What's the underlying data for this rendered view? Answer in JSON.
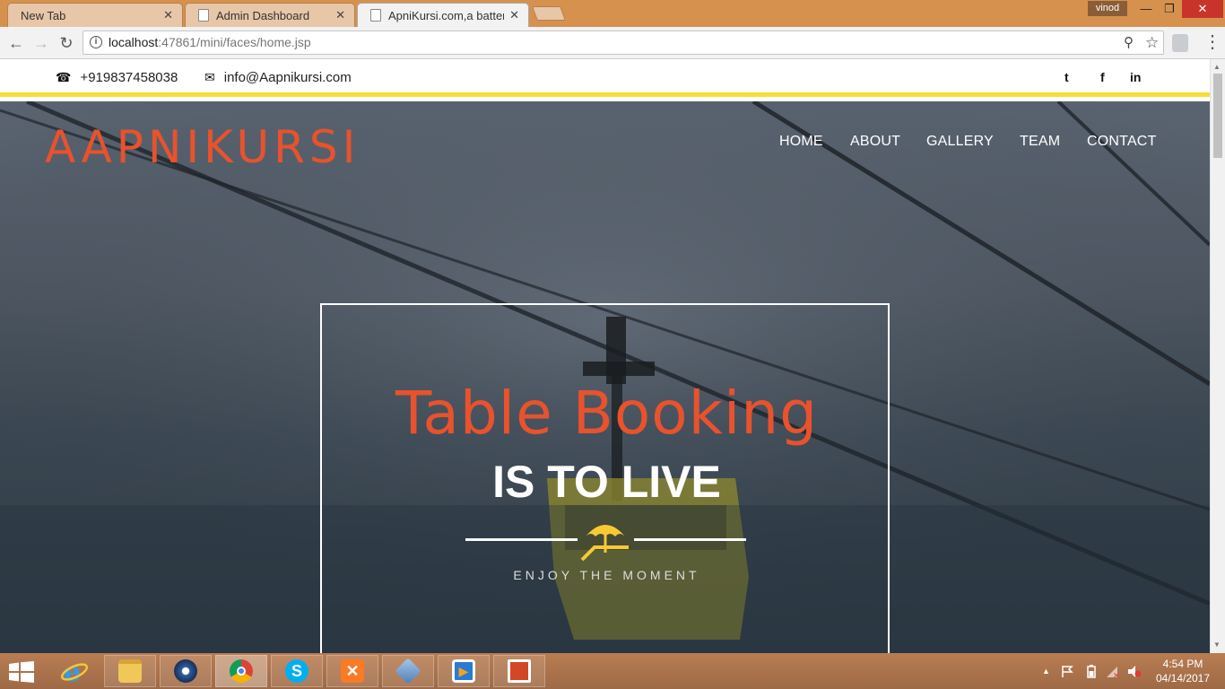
{
  "browser": {
    "tabs": [
      {
        "title": "New Tab",
        "close": "✕"
      },
      {
        "title": "Admin Dashboard",
        "close": "✕"
      },
      {
        "title": "ApniKursi.com,a batter w",
        "close": "✕"
      }
    ],
    "profile_name": "vinod",
    "window_controls": {
      "minimize": "—",
      "restore": "❐",
      "close": "✕"
    },
    "url": {
      "host": "localhost",
      "rest": ":47861/mini/faces/home.jsp"
    },
    "nav": {
      "back": "←",
      "forward": "→",
      "reload": "↻"
    },
    "omnibox_icons": {
      "info": "i",
      "zoom": "⚲",
      "bookmark": "☆",
      "menu": "⋮"
    }
  },
  "site": {
    "contact": {
      "phone_icon": "☎",
      "phone": "+919837458038",
      "email_icon": "✉",
      "email": "info@Aapnikursi.com"
    },
    "social": {
      "twitter": "t",
      "facebook": "f",
      "linkedin": "in"
    },
    "logo": "AAPNIKURSI",
    "nav": [
      "HOME",
      "ABOUT",
      "GALLERY",
      "TEAM",
      "CONTACT"
    ],
    "hero": {
      "headline": "Table Booking",
      "subhead": "IS TO LIVE",
      "tagline": "ENJOY THE MOMENT"
    }
  },
  "theme": {
    "accent": "#e8522c",
    "stripe": "#f7dd36",
    "umbrella": "#f7c933"
  },
  "taskbar": {
    "apps": [
      "internet-explorer",
      "file-explorer",
      "media-player",
      "chrome",
      "skype",
      "xampp",
      "virtualbox",
      "video-app",
      "presentation-app"
    ],
    "tray_arrow": "▲",
    "clock_time": "4:54 PM",
    "clock_date": "04/14/2017"
  }
}
